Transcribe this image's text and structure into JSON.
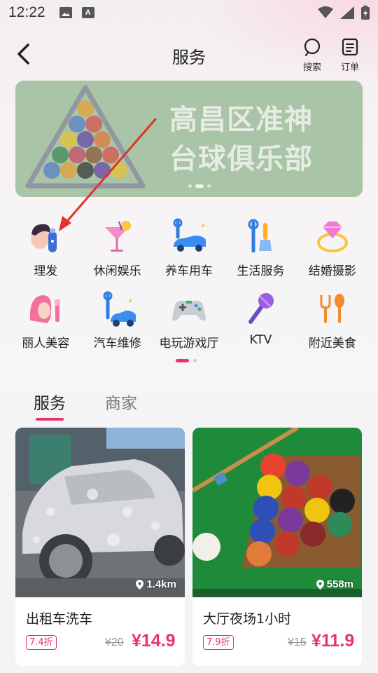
{
  "status_bar": {
    "time": "12:22",
    "icons": [
      "image-icon",
      "a-letter-icon",
      "wifi-icon",
      "signal-icon",
      "battery-icon"
    ]
  },
  "header": {
    "title": "服务",
    "search_label": "搜索",
    "orders_label": "订单"
  },
  "banner": {
    "title_line1": "高昌区准神",
    "title_line2": "台球俱乐部",
    "dots": 3,
    "active_dot": 1
  },
  "categories": [
    {
      "label": "理发",
      "icon": "haircut-icon"
    },
    {
      "label": "休闲娱乐",
      "icon": "cocktail-icon"
    },
    {
      "label": "养车用车",
      "icon": "car-service-icon"
    },
    {
      "label": "生活服务",
      "icon": "tools-icon"
    },
    {
      "label": "结婚摄影",
      "icon": "diamond-ring-icon"
    },
    {
      "label": "丽人美容",
      "icon": "beauty-icon"
    },
    {
      "label": "汽车维修",
      "icon": "car-repair-icon"
    },
    {
      "label": "电玩游戏厅",
      "icon": "gamepad-icon"
    },
    {
      "label": "KTV",
      "icon": "microphone-icon"
    },
    {
      "label": "附近美食",
      "icon": "food-icon"
    }
  ],
  "category_pages": {
    "count": 2,
    "active": 0
  },
  "tabs": [
    {
      "label": "服务",
      "active": true
    },
    {
      "label": "商家",
      "active": false
    }
  ],
  "cards": [
    {
      "title": "出租车洗车",
      "distance": "1.4km",
      "discount": "7.4折",
      "original_price": "¥20",
      "price": "¥14.9"
    },
    {
      "title": "大厅夜场1小时",
      "distance": "558m",
      "discount": "7.9折",
      "original_price": "¥15",
      "price": "¥11.9"
    }
  ],
  "colors": {
    "accent": "#e8356b",
    "banner_bg": "#a9c4a6",
    "table_green": "#1f8a3a"
  }
}
